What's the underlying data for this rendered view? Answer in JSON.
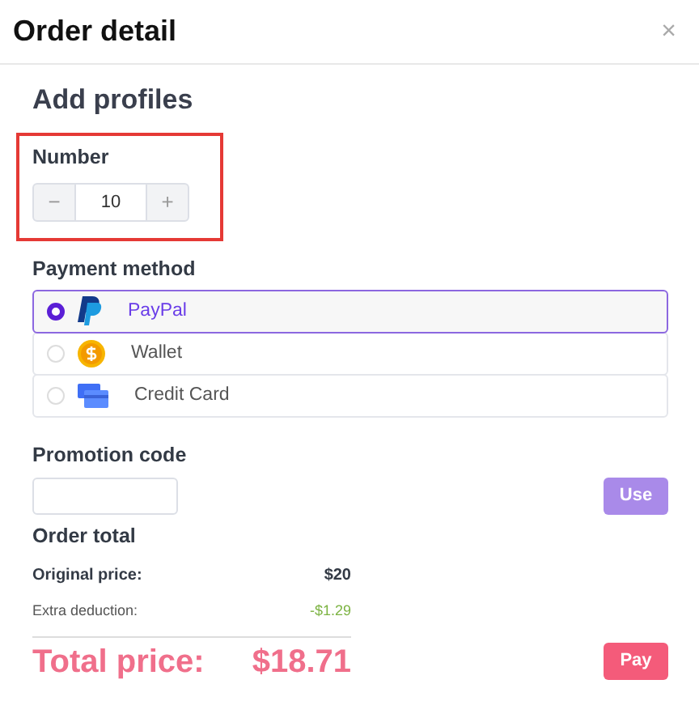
{
  "window": {
    "title": "Order detail",
    "close": "×"
  },
  "section_title": "Add profiles",
  "number": {
    "label": "Number",
    "highlighted": true,
    "decrement": "−",
    "value": "10",
    "increment": "+"
  },
  "payment": {
    "label": "Payment method",
    "options": [
      {
        "label": "PayPal",
        "kind": "paypal",
        "selected": true
      },
      {
        "label": "Wallet",
        "kind": "coin",
        "selected": false
      },
      {
        "label": "Credit Card",
        "kind": "card",
        "selected": false
      }
    ]
  },
  "promotion": {
    "label": "Promotion code",
    "button": "Use"
  },
  "order_total": {
    "title": "Order total",
    "original_label": "Original price:",
    "original_value": "$20",
    "deduction_label": "Extra deduction:",
    "deduction_value": "-$1.29",
    "total_label": "Total price:",
    "total_value": "$18.71",
    "pay_button": "Pay"
  }
}
